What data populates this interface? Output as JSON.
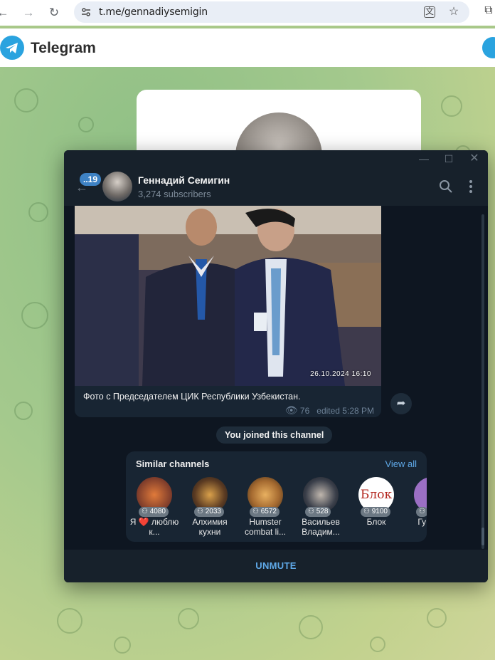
{
  "browser": {
    "url": "t.me/gennadiysemigin"
  },
  "tg_web": {
    "title": "Telegram"
  },
  "window": {
    "channel_name": "Геннадий Семигин",
    "subscribers": "3,274 subscribers",
    "unread_badge": "..19",
    "message": {
      "photo_date": "26.10.2024 16:10",
      "caption": "Фото с Председателем ЦИК Республики Узбекистан.",
      "views": "76",
      "edited": "edited 5:28 PM"
    },
    "service_text": "You joined this channel",
    "similar": {
      "title": "Similar channels",
      "view_all": "View all",
      "channels": [
        {
          "count": "4080",
          "name": "Я ❤️ люблю к..."
        },
        {
          "count": "2033",
          "name": "Алхимия кухни"
        },
        {
          "count": "6572",
          "name": "Humster combat li..."
        },
        {
          "count": "528",
          "name": "Васильев Владим..."
        },
        {
          "count": "9100",
          "name": "Блок"
        },
        {
          "count": "",
          "name": "Гу глав"
        }
      ]
    },
    "unmute_label": "UNMUTE"
  },
  "colors": {
    "telegram_blue": "#2aa3df",
    "dark_bg": "#0e1621",
    "panel": "#17212b",
    "bubble": "#182533",
    "link": "#5fa9e8"
  }
}
